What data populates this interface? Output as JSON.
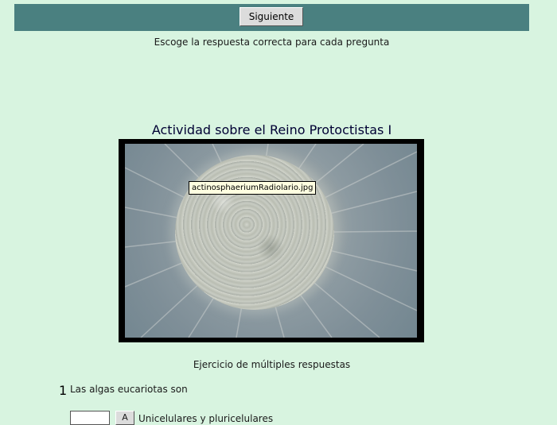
{
  "toolbar": {
    "next_label": "Siguiente"
  },
  "instruction": "Escoge la respuesta correcta para cada pregunta",
  "activity_title": "Actividad sobre el Reino Protoctistas I",
  "image": {
    "tooltip": "actinosphaeriumRadiolario.jpg"
  },
  "exercise_type": "Ejercicio de múltiples respuestas",
  "question": {
    "number": "1",
    "text": "Las algas eucariotas son",
    "option_letter": "A",
    "option_text": "Unicelulares y pluricelulares"
  },
  "colors": {
    "background": "#d8f4e0",
    "topbar": "#4a8080",
    "title": "#000033"
  }
}
